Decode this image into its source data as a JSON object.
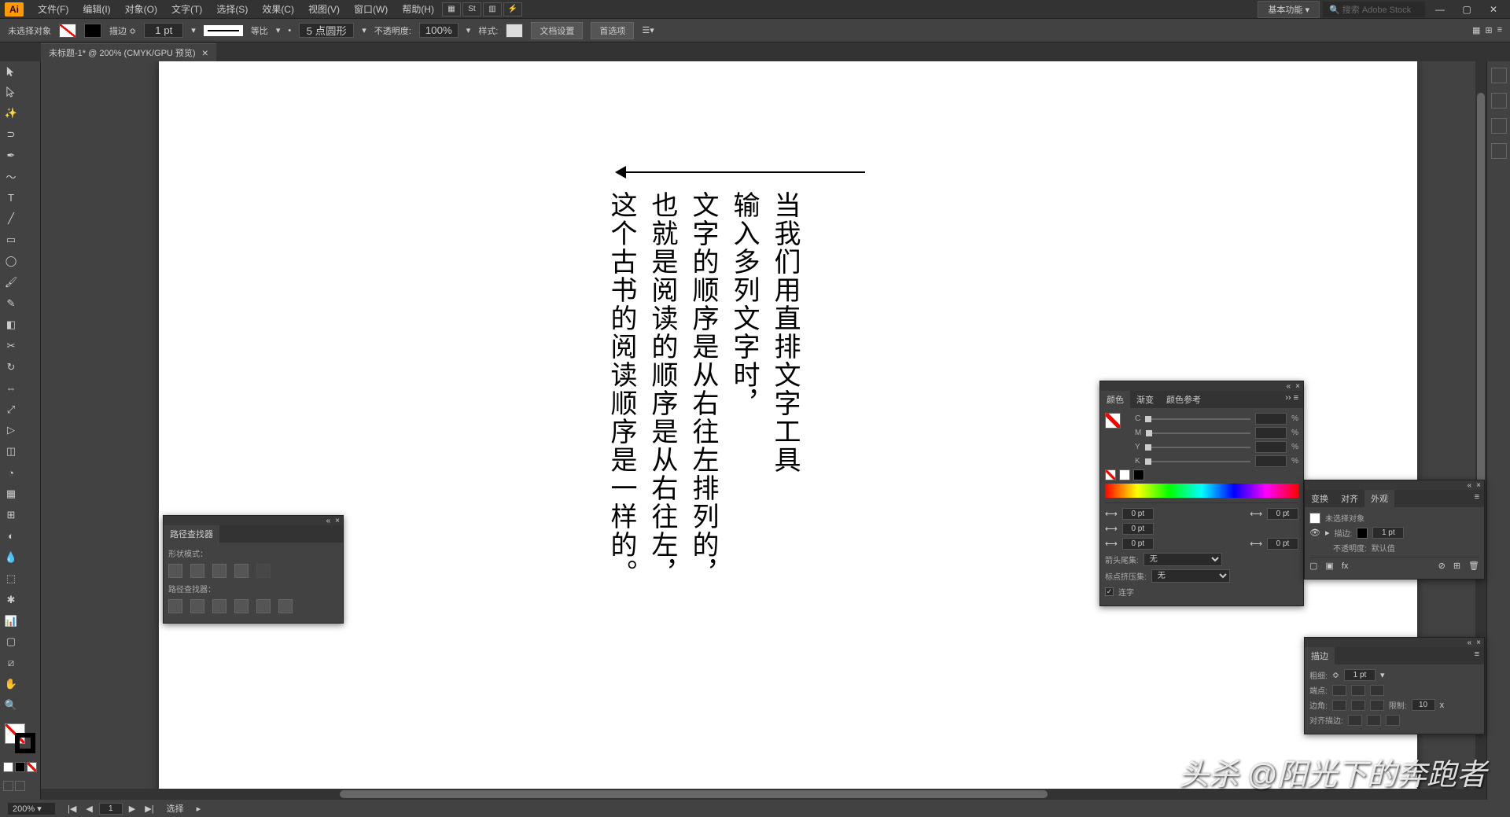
{
  "menubar": {
    "logo": "Ai",
    "items": [
      "文件(F)",
      "编辑(I)",
      "对象(O)",
      "文字(T)",
      "选择(S)",
      "效果(C)",
      "视图(V)",
      "窗口(W)",
      "帮助(H)"
    ],
    "workspaceLabel": "基本功能 ▾",
    "searchPlaceholder": "搜索 Adobe Stock"
  },
  "controlbar": {
    "selectionStatus": "未选择对象",
    "strokeLabel": "描边 ≎",
    "strokeWeight": "1 pt",
    "strokeStyleLabel": "等比",
    "brushLabel": "5 点圆形",
    "opacityLabel": "不透明度:",
    "opacityValue": "100%",
    "styleLabel": "样式:",
    "docSetup": "文档设置",
    "prefs": "首选项"
  },
  "tab": {
    "label": "未标题-1* @ 200% (CMYK/GPU 预览)",
    "close": "×"
  },
  "canvas": {
    "columns": [
      "当我们用直排文字工具",
      "输入多列文字时，",
      "文字的顺序是从右往左排列的，",
      "也就是阅读的顺序是从右往左，",
      "这个古书的阅读顺序是一样的。"
    ]
  },
  "pathfinder": {
    "title": "路径查找器",
    "shapesLabel": "形状模式：",
    "pathfinderLabel": "路径查找器："
  },
  "colorPanel": {
    "tabs": [
      "颜色",
      "渐变",
      "颜色参考"
    ],
    "channels": [
      "C",
      "M",
      "Y",
      "K"
    ],
    "pct": "%",
    "fields": [
      {
        "label": "间距",
        "value": "0 pt"
      },
      {
        "label": "",
        "value": "0 pt"
      },
      {
        "label": "",
        "value": "0 pt"
      },
      {
        "label": "",
        "value": "0 pt"
      },
      {
        "label": "",
        "value": "0 pt"
      }
    ],
    "arrowheadLabel": "箭头尾集:",
    "arrowheadValue": "无",
    "scaleLabel": "标点挤压集:",
    "scaleValue": "无",
    "linkLabel": "连字"
  },
  "appearancePanel": {
    "tabs": [
      "变换",
      "对齐",
      "外观"
    ],
    "noSelection": "未选择对象",
    "strokeLabel": "描边:",
    "strokeValue": "1 pt",
    "opacityLabel": "不透明度:",
    "opacityValue": "默认值"
  },
  "strokePanel": {
    "title": "描边",
    "weightLabel": "粗细:",
    "weightValue": "1 pt",
    "capLabel": "端点:",
    "cornerLabel": "边角:",
    "limitLabel": "限制:",
    "limitValue": "10",
    "alignLabel": "对齐描边:"
  },
  "status": {
    "zoom": "200%",
    "artboard": "1",
    "tool": "选择"
  },
  "watermark": "头杀 @阳光下的奔跑者"
}
